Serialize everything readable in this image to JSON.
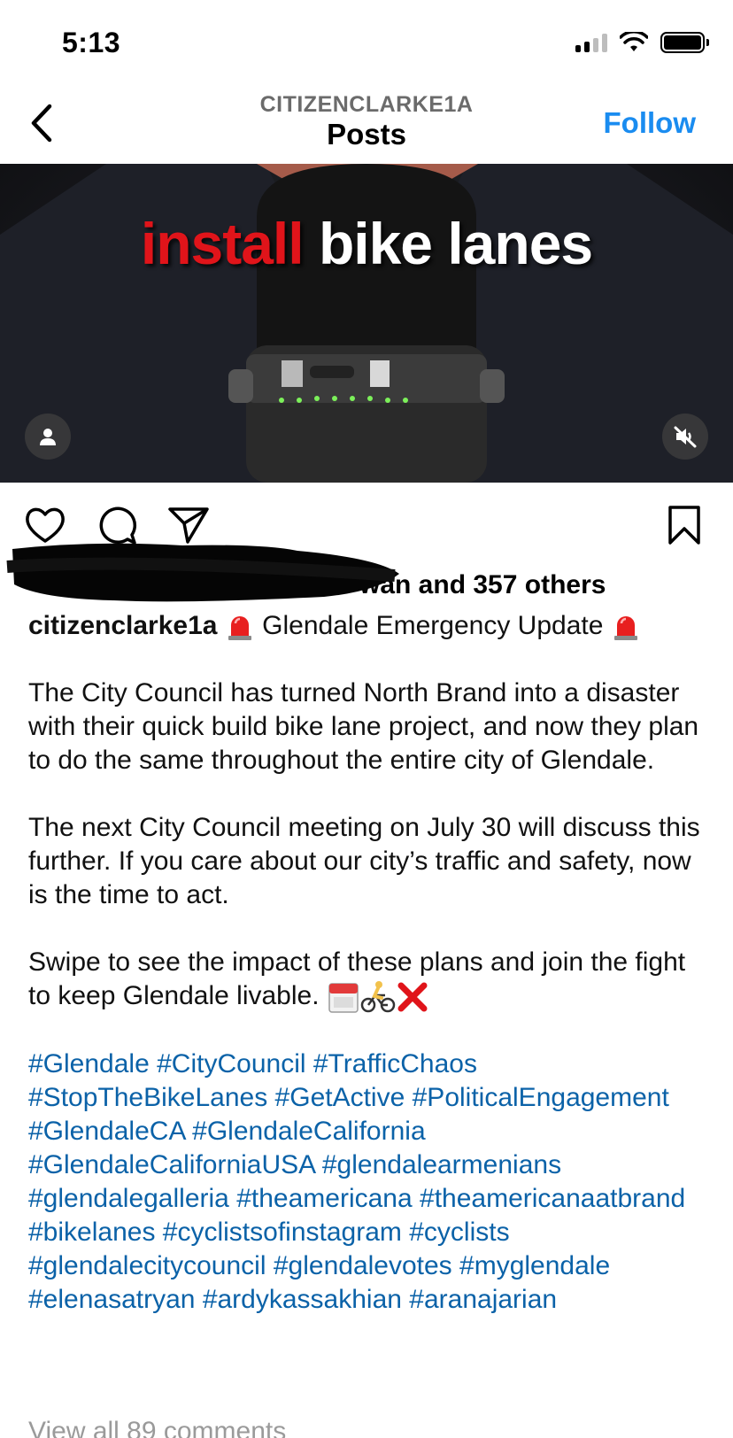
{
  "status_bar": {
    "time": "5:13"
  },
  "header": {
    "username": "CITIZENCLARKE1A",
    "title": "Posts",
    "follow_label": "Follow"
  },
  "media": {
    "overlay_word_1": "install",
    "overlay_word_2": "bike lanes"
  },
  "likes": {
    "text_visible_tail": "wan and ",
    "count_text": "357 others"
  },
  "post": {
    "author": "citizenclarke1a",
    "headline": "Glendale Emergency Update",
    "paragraph_1": "The City Council has turned North Brand into a disaster with their quick build bike lane project, and now they plan to do the same throughout the entire city of Glendale.",
    "paragraph_2": "The next City Council meeting on July 30 will discuss this further. If you care about our city’s traffic and safety, now is the time to act.",
    "paragraph_3": "Swipe to see the impact of these plans and join the fight to keep Glendale livable.",
    "hashtags": [
      "#Glendale",
      "#CityCouncil",
      "#TrafficChaos",
      "#StopTheBikeLanes",
      "#GetActive",
      "#PoliticalEngagement",
      "#GlendaleCA",
      "#GlendaleCalifornia",
      "#GlendaleCaliforniaUSA",
      "#glendalearmenians",
      "#glendalegalleria",
      "#theamericana",
      "#theamericanaatbrand",
      "#bikelanes",
      "#cyclistsofinstagram",
      "#cyclists",
      "#glendalecitycouncil",
      "#glendalevotes",
      "#myglendale",
      "#elenasatryan",
      "#ardykassakhian",
      "#aranajarian"
    ]
  },
  "comments": {
    "view_all_label": "View all 89 comments"
  },
  "icons": [
    "back-chevron-icon",
    "heart-icon",
    "comment-icon",
    "share-icon",
    "bookmark-icon",
    "person-tag-icon",
    "mute-icon",
    "siren-emoji-icon",
    "calendar-emoji-icon",
    "cyclist-emoji-icon",
    "cross-mark-emoji-icon"
  ],
  "colors": {
    "accent": "#1a8cf0",
    "hashtag": "#0b62a8",
    "overlay_red": "#e0141a"
  }
}
